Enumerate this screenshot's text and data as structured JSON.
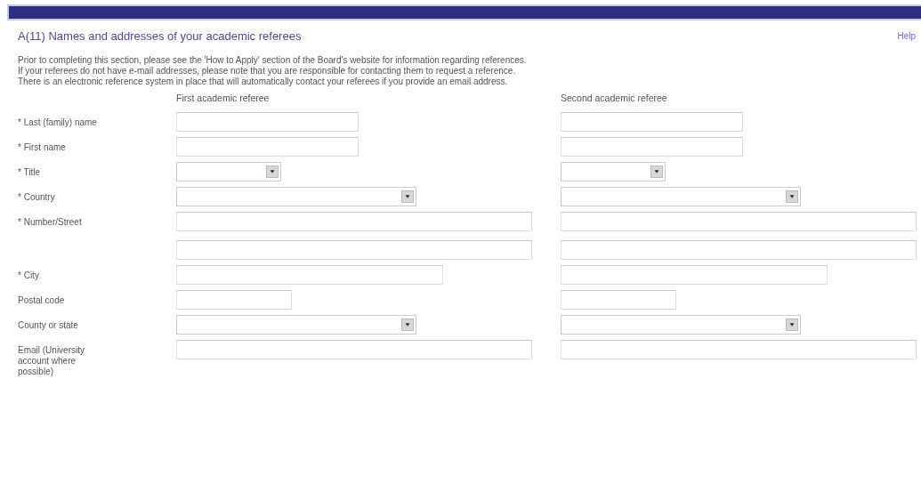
{
  "section": {
    "title": "A(11) Names and addresses of your academic referees",
    "help_link": "Help"
  },
  "instructions": [
    "Prior to completing this section, please see the 'How to Apply' section of the Board's website for information regarding references.",
    "If your referees do not have e-mail addresses, please note that you are responsible for contacting them to request a reference.",
    "There is an electronic reference system in place that will automatically contact your referees if you provide an email address."
  ],
  "columns": [
    "First academic referee",
    "Second academic referee"
  ],
  "rows": [
    {
      "label": "* Last (family) name",
      "kind": "text"
    },
    {
      "label": "* First name",
      "kind": "text"
    },
    {
      "label": "* Title",
      "kind": "select"
    },
    {
      "label": "* Country",
      "kind": "select"
    },
    {
      "label": "* Number/Street",
      "kind": "text-pair"
    },
    {
      "label": "* City",
      "kind": "text"
    },
    {
      "label": "Postal code",
      "kind": "text"
    },
    {
      "label": "County or state",
      "kind": "select"
    },
    {
      "label": "Email (University account where possible)",
      "kind": "text"
    }
  ]
}
